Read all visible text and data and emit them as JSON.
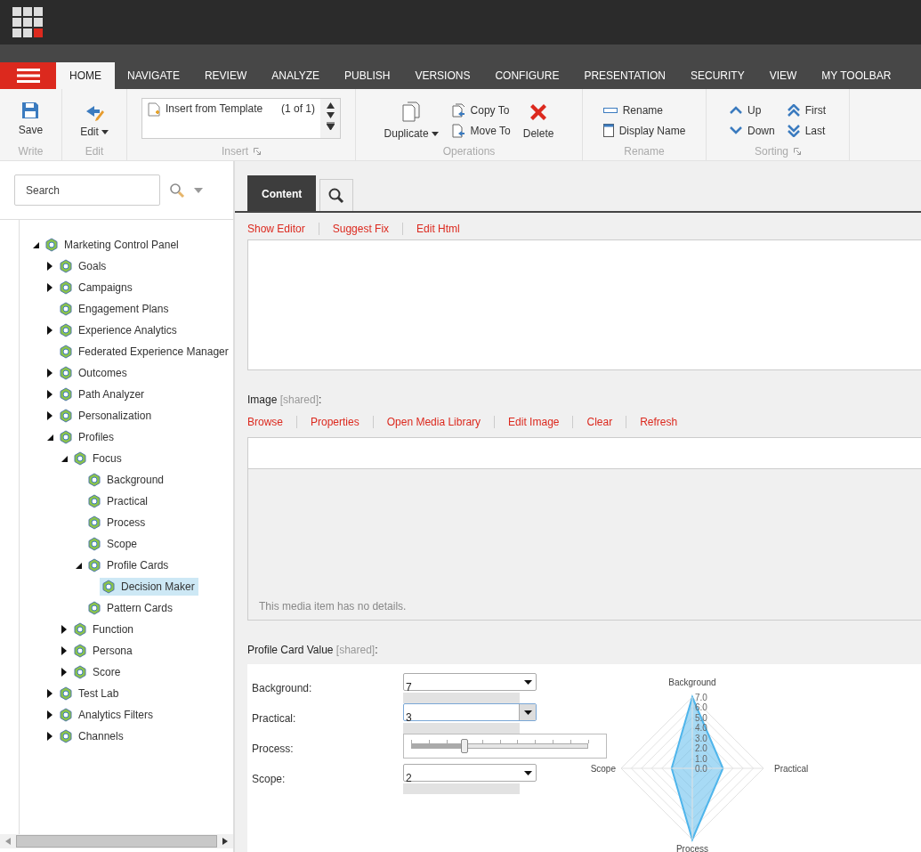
{
  "tabs": [
    {
      "label": "HOME",
      "selected": true
    },
    {
      "label": "NAVIGATE",
      "selected": false
    },
    {
      "label": "REVIEW",
      "selected": false
    },
    {
      "label": "ANALYZE",
      "selected": false
    },
    {
      "label": "PUBLISH",
      "selected": false
    },
    {
      "label": "VERSIONS",
      "selected": false
    },
    {
      "label": "CONFIGURE",
      "selected": false
    },
    {
      "label": "PRESENTATION",
      "selected": false
    },
    {
      "label": "SECURITY",
      "selected": false
    },
    {
      "label": "VIEW",
      "selected": false
    },
    {
      "label": "MY TOOLBAR",
      "selected": false
    }
  ],
  "ribbon": {
    "write": {
      "label": "Write",
      "save": "Save"
    },
    "edit": {
      "label": "Edit",
      "button": "Edit"
    },
    "insert": {
      "label": "Insert",
      "item": "Insert from Template",
      "count": "(1 of 1)"
    },
    "operations": {
      "label": "Operations",
      "duplicate": "Duplicate",
      "copy": "Copy To",
      "move": "Move To",
      "delete": "Delete"
    },
    "rename": {
      "label": "Rename",
      "rename": "Rename",
      "display": "Display Name"
    },
    "sorting": {
      "label": "Sorting",
      "up": "Up",
      "down": "Down",
      "first": "First",
      "last": "Last"
    }
  },
  "search": {
    "placeholder": "Search"
  },
  "tree": [
    {
      "label": "Marketing Control Panel",
      "expanded": true,
      "selected": false,
      "children": [
        {
          "label": "Goals",
          "expanded": false,
          "selected": false
        },
        {
          "label": "Campaigns",
          "expanded": false,
          "selected": false
        },
        {
          "label": "Engagement Plans",
          "selected": false
        },
        {
          "label": "Experience Analytics",
          "expanded": false,
          "selected": false
        },
        {
          "label": "Federated Experience Manager",
          "selected": false
        },
        {
          "label": "Outcomes",
          "expanded": false,
          "selected": false
        },
        {
          "label": "Path Analyzer",
          "expanded": false,
          "selected": false
        },
        {
          "label": "Personalization",
          "expanded": false,
          "selected": false
        },
        {
          "label": "Profiles",
          "expanded": true,
          "selected": false,
          "children": [
            {
              "label": "Focus",
              "expanded": true,
              "selected": false,
              "children": [
                {
                  "label": "Background",
                  "selected": false
                },
                {
                  "label": "Practical",
                  "selected": false
                },
                {
                  "label": "Process",
                  "selected": false
                },
                {
                  "label": "Scope",
                  "selected": false
                },
                {
                  "label": "Profile Cards",
                  "expanded": true,
                  "selected": false,
                  "children": [
                    {
                      "label": "Decision Maker",
                      "selected": true
                    }
                  ]
                },
                {
                  "label": "Pattern Cards",
                  "selected": false
                }
              ]
            },
            {
              "label": "Function",
              "expanded": false,
              "selected": false
            },
            {
              "label": "Persona",
              "expanded": false,
              "selected": false
            },
            {
              "label": "Score",
              "expanded": false,
              "selected": false
            }
          ]
        },
        {
          "label": "Test Lab",
          "expanded": false,
          "selected": false
        },
        {
          "label": "Analytics Filters",
          "expanded": false,
          "selected": false
        },
        {
          "label": "Channels",
          "expanded": false,
          "selected": false
        }
      ]
    }
  ],
  "content_tabs": [
    {
      "kind": "text",
      "label": "Content",
      "selected": true
    },
    {
      "kind": "search",
      "selected": false
    }
  ],
  "editor_links": [
    "Show Editor",
    "Suggest Fix",
    "Edit Html"
  ],
  "image": {
    "label": "Image",
    "shared": "[shared]",
    "end": ":",
    "links": [
      "Browse",
      "Properties",
      "Open Media Library",
      "Edit Image",
      "Clear",
      "Refresh"
    ],
    "note": "This media item has no details."
  },
  "profile": {
    "label": "Profile Card Value",
    "shared": "[shared]",
    "end": ":",
    "fields": [
      {
        "label": "Background:",
        "kind": "dropdown",
        "value": "7",
        "focused": false
      },
      {
        "label": "Practical:",
        "kind": "dropdown",
        "value": "3",
        "focused": true
      },
      {
        "label": "Process:",
        "kind": "slider",
        "level": 0.3
      },
      {
        "label": "Scope:",
        "kind": "dropdown",
        "value": "2",
        "focused": false
      }
    ],
    "radar": {
      "axes": [
        {
          "label": "Background"
        },
        {
          "label": "Practical"
        },
        {
          "label": "Process"
        },
        {
          "label": "Scope"
        }
      ],
      "ticks": [
        "7.0",
        "6.0",
        "5.0",
        "4.0",
        "3.0",
        "2.0",
        "1.0",
        "0.0"
      ]
    }
  }
}
